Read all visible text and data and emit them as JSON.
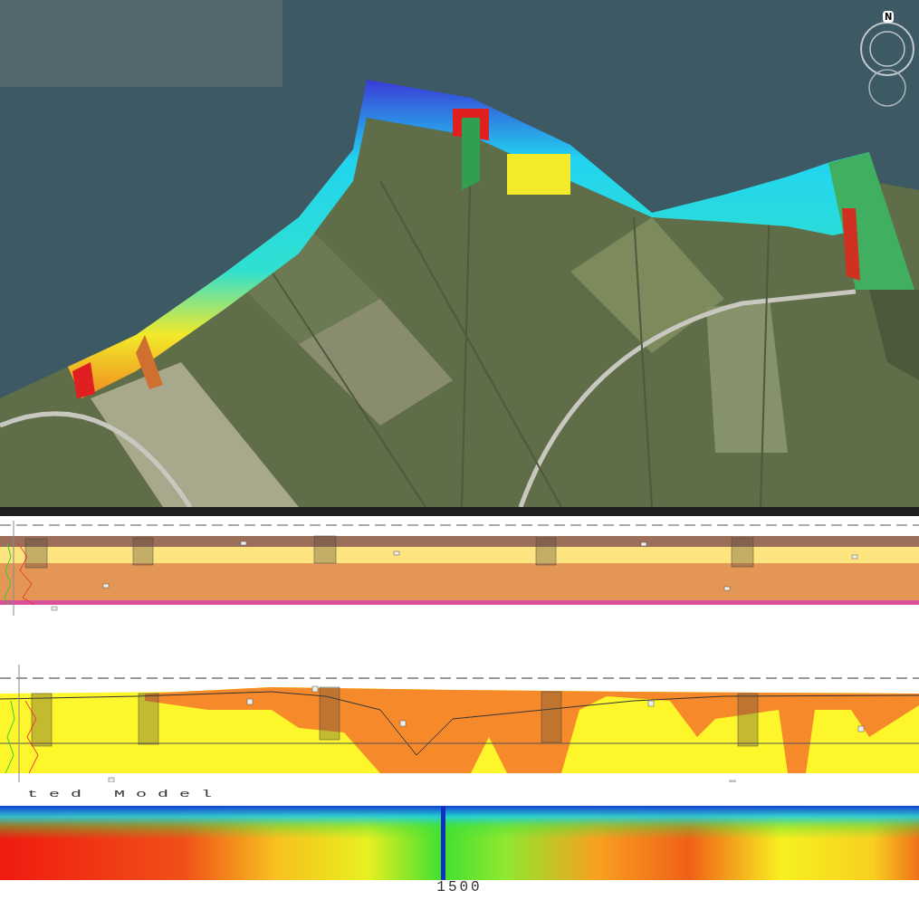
{
  "compass": {
    "label": "N"
  },
  "model_section": {
    "title": "ted Model",
    "axis_label": "1500"
  }
}
